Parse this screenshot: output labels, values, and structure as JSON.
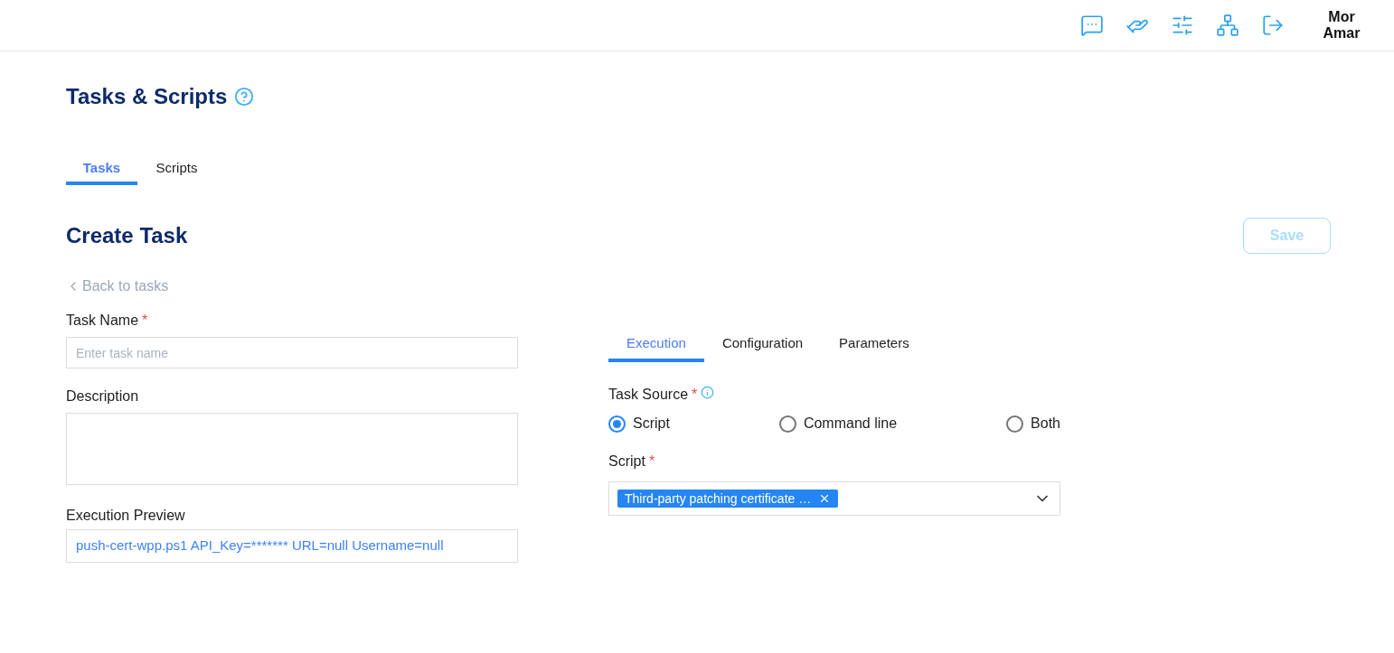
{
  "header": {
    "user_name": "Mor Amar"
  },
  "page": {
    "title": "Tasks & Scripts"
  },
  "tabs": [
    {
      "label": "Tasks",
      "selected": true
    },
    {
      "label": "Scripts",
      "selected": false
    }
  ],
  "form": {
    "title": "Create Task",
    "save_button": {
      "label": "Save",
      "disabled": true
    },
    "back_link": "Back to tasks",
    "task_name": {
      "label": "Task Name",
      "required_mark": "*",
      "placeholder": "Enter task name"
    },
    "description": {
      "label": "Description"
    },
    "execution_preview": {
      "label": "Execution Preview",
      "value": "push-cert-wpp.ps1 API_Key=******* URL=null Username=null"
    }
  },
  "detail_tabs": [
    {
      "label": "Execution",
      "selected": true
    },
    {
      "label": "Configuration",
      "selected": false
    },
    {
      "label": "Parameters",
      "selected": false
    }
  ],
  "task_source": {
    "label": "Task Source",
    "required_mark": "*",
    "options": [
      {
        "label": "Script",
        "selected": true
      },
      {
        "label": "Command line",
        "selected": false
      },
      {
        "label": "Both",
        "selected": false
      }
    ]
  },
  "script": {
    "label": "Script",
    "required_mark": "*",
    "tags": [
      "Third-party patching certificate …"
    ]
  }
}
